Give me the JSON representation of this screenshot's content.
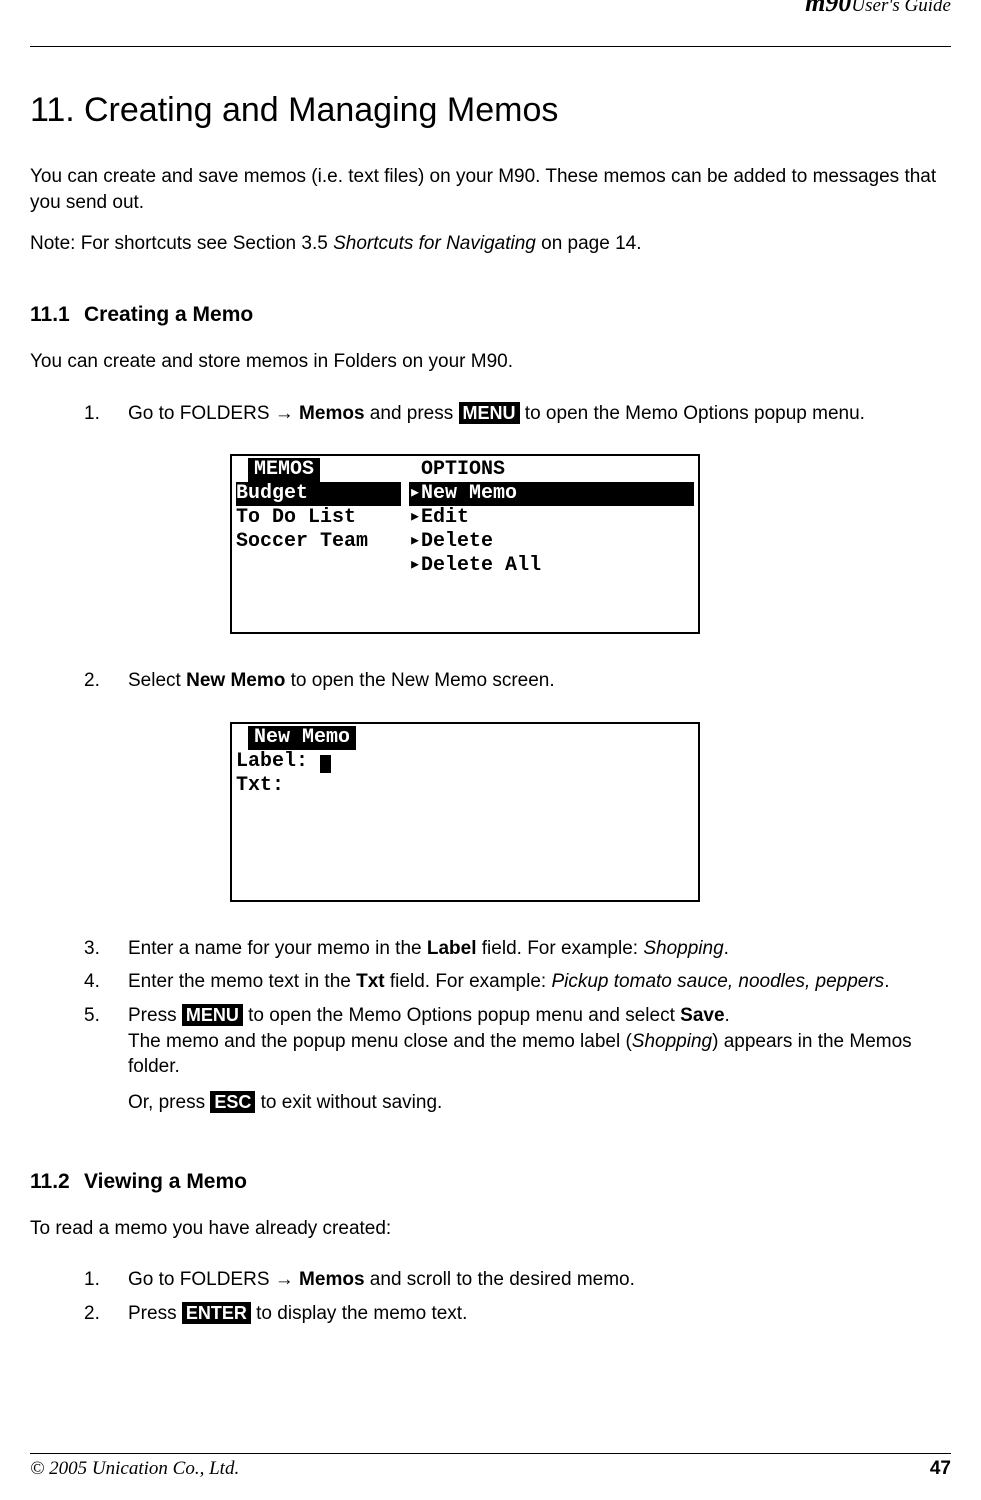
{
  "header": {
    "brand": "m90",
    "guide": "User's Guide"
  },
  "chapter": {
    "num": "11.",
    "title": "Creating and Managing Memos"
  },
  "intro": {
    "p1": "You can create and save memos (i.e. text files) on your M90. These memos can be added to messages that you send out.",
    "note_prefix": "Note: For shortcuts see Section 3.5 ",
    "note_italic": "Shortcuts for Navigating",
    "note_suffix": " on page 14."
  },
  "s11_1": {
    "num": "11.1",
    "title": "Creating a Memo",
    "lead": "You can create and store memos in Folders on your M90.",
    "step1": {
      "n": "1.",
      "t1": "Go to FOLDERS ",
      "arrow": "→",
      "t_bold1": " Memos",
      "t2": " and press ",
      "key": "MENU",
      "t3": " to open the Memo Options popup menu."
    },
    "screen1": {
      "left_title": "MEMOS",
      "left_sel": "Budget",
      "left_items": [
        "To Do List",
        "Soccer Team"
      ],
      "right_title": "OPTIONS",
      "right_sel": "New Memo",
      "right_items": [
        "Edit",
        "Delete",
        "Delete All"
      ]
    },
    "step2": {
      "n": "2.",
      "t1": "Select ",
      "bold": "New Memo",
      "t2": " to open the New Memo screen."
    },
    "screen2": {
      "title": "New Memo",
      "label_key": "Label: ",
      "txt_key": "Txt:"
    },
    "step3": {
      "n": "3.",
      "t1": "Enter a name for your memo in the ",
      "bold1": "Label",
      "t2": " field. For example: ",
      "italic": "Shopping",
      "t3": "."
    },
    "step4": {
      "n": "4.",
      "t1": "Enter the memo text in the ",
      "bold1": "Txt",
      "t2": " field. For example: ",
      "italic": "Pickup tomato sauce, noodles, peppers",
      "t3": "."
    },
    "step5": {
      "n": "5.",
      "t1": "Press ",
      "key1": "MENU",
      "t2": " to open the Memo Options popup menu and select ",
      "bold": "Save",
      "t3": ".",
      "t4": "The memo and the popup menu close and the memo label (",
      "italic": "Shopping",
      "t5": ") appears in the Memos folder.",
      "or1": "Or, press ",
      "key2": "ESC",
      "or2": " to exit without saving."
    }
  },
  "s11_2": {
    "num": "11.2",
    "title": "Viewing a Memo",
    "lead": "To read a memo you have already created:",
    "step1": {
      "n": "1.",
      "t1": "Go to FOLDERS ",
      "arrow": "→",
      "bold": " Memos",
      "t2": " and scroll to the desired memo."
    },
    "step2": {
      "n": "2.",
      "t1": "Press ",
      "key": "ENTER",
      "t2": " to display the memo text."
    }
  },
  "footer": {
    "copyright": "© 2005 Unication Co., Ltd.",
    "page": "47"
  }
}
